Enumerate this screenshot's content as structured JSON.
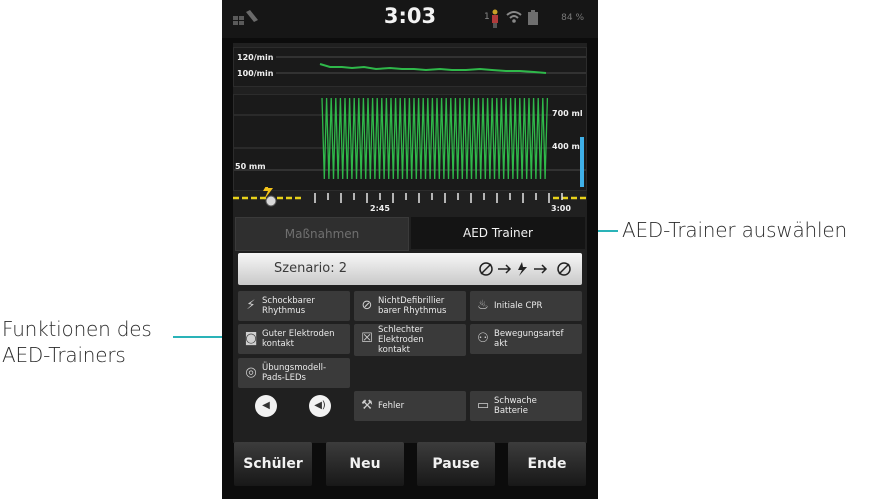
{
  "annotations": {
    "right": "AED-Trainer auswählen",
    "left_line1": "Funktionen des",
    "left_line2": "AED-Trainers"
  },
  "status_bar": {
    "time": "3:03",
    "user_count": "1",
    "battery": "84 %",
    "icons": [
      "tools-icon",
      "person-icon",
      "wifi-icon",
      "battery-icon"
    ]
  },
  "rate_chart": {
    "label_top": "120/min",
    "label_bottom": "100/min"
  },
  "depth_chart": {
    "label_left": "50 mm",
    "label_700": "700 ml",
    "label_400": "400 ml"
  },
  "timeline": {
    "tick_label_1": "2:45",
    "tick_label_2": "3:00"
  },
  "tabs": {
    "inactive": "Maßnahmen",
    "active": "AED Trainer"
  },
  "scenario": {
    "label": "Szenario: 2"
  },
  "functions": {
    "shockable": [
      "Schockbarer",
      "Rhythmus"
    ],
    "non_shockable": [
      "NichtDefibrillier",
      "barer Rhythmus"
    ],
    "initial_cpr": "Initiale CPR",
    "good_contact": [
      "Guter Elektroden",
      "kontakt"
    ],
    "bad_contact": [
      "Schlechter",
      "Elektroden",
      "kontakt"
    ],
    "motion": [
      "Bewegungsartef",
      "akt"
    ],
    "pads_leds": [
      "Übungsmodell-",
      "Pads-LEDs"
    ],
    "fault": "Fehler",
    "low_battery": [
      "Schwache",
      "Batterie"
    ]
  },
  "bottom_buttons": {
    "student": "Schüler",
    "new": "Neu",
    "pause": "Pause",
    "end": "Ende"
  },
  "colors": {
    "accent": "#2ab3b8",
    "wave_green": "#2fb84a",
    "timeline_yellow": "#e8d21a"
  }
}
